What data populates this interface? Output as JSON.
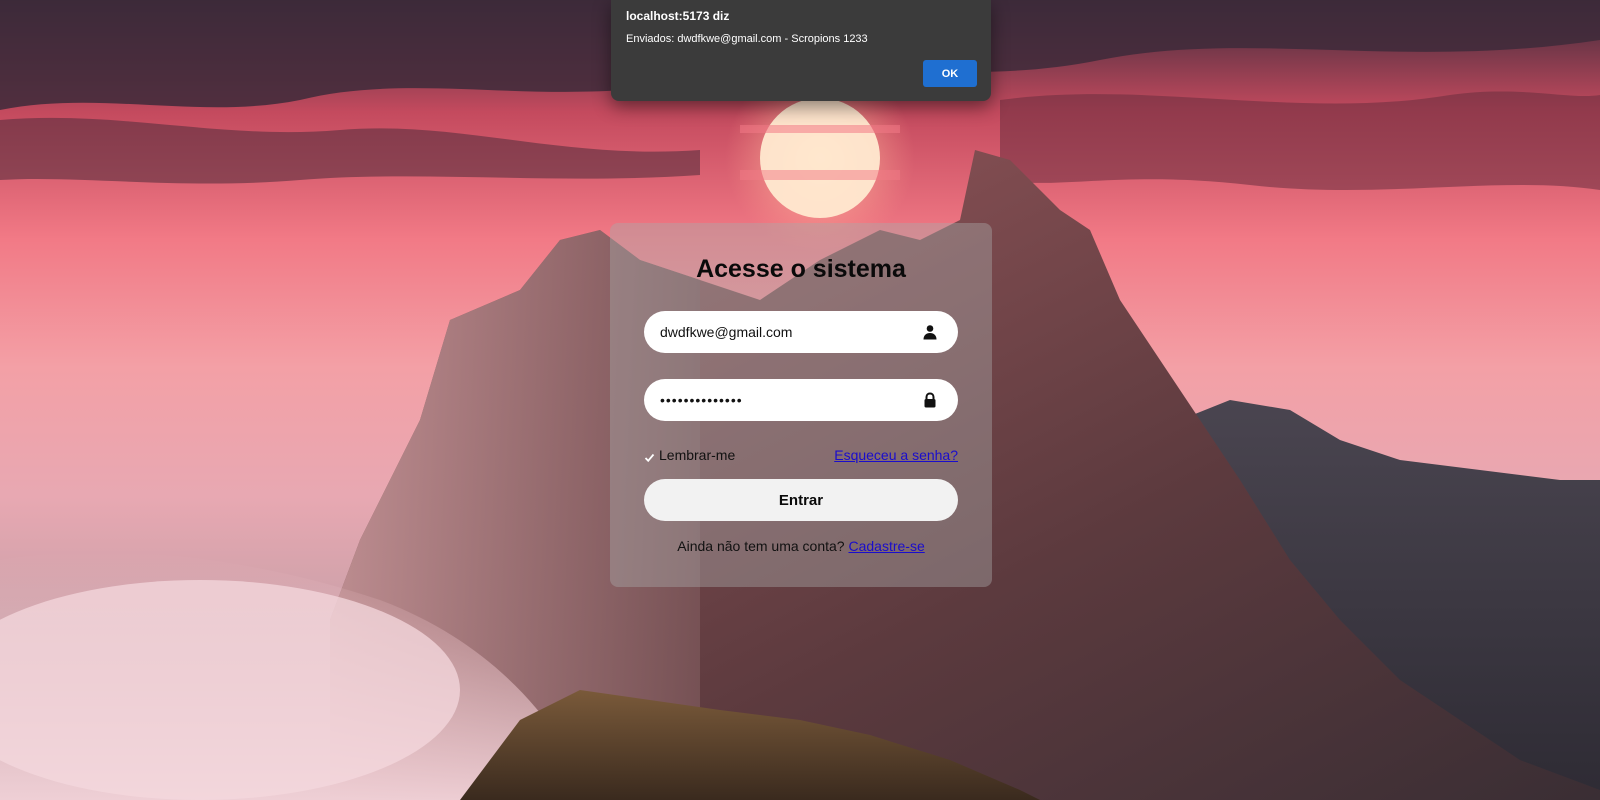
{
  "alert": {
    "title": "localhost:5173 diz",
    "message": "Enviados: dwdfkwe@gmail.com - Scropions 1233",
    "ok_label": "OK"
  },
  "login": {
    "title": "Acesse o sistema",
    "email_value": "dwdfkwe@gmail.com",
    "password_value": "••••••••••••••",
    "remember_label": "Lembrar-me",
    "remember_checked": true,
    "forgot_label": "Esqueceu a senha?",
    "submit_label": "Entrar",
    "signup_prompt": "Ainda não tem uma conta?",
    "signup_link": "Cadastre-se"
  },
  "icons": {
    "email_field": "user-icon",
    "password_field": "lock-icon",
    "checkbox": "checkmark-icon"
  },
  "colors": {
    "alert_bg": "#3b3b3b",
    "ok_button": "#1f6fd1",
    "link": "#1a0dcc",
    "card_bg": "rgba(170,170,170,0.42)"
  }
}
